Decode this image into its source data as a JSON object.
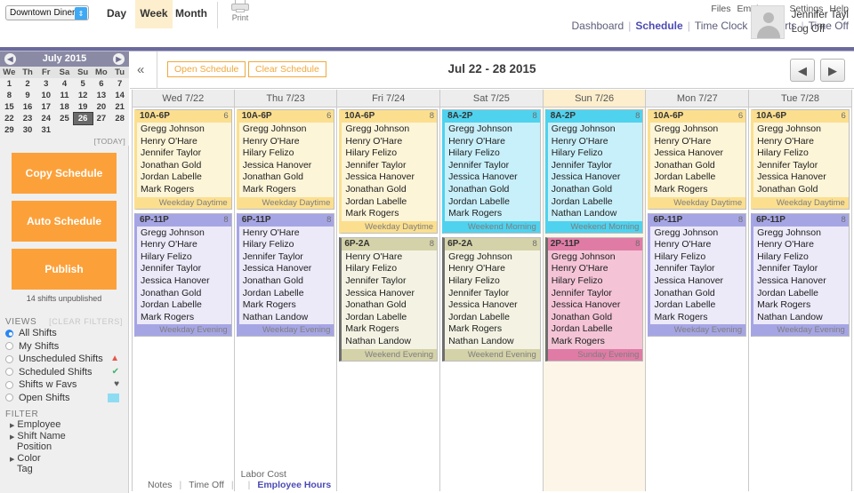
{
  "topbar": {
    "store": "Downtown Diner",
    "views": [
      {
        "label": "Day",
        "active": false
      },
      {
        "label": "Week",
        "active": true
      },
      {
        "label": "Month",
        "active": false
      }
    ],
    "print_label": "Print",
    "secondary_links": [
      "Files",
      "Employees",
      "Settings",
      "Help"
    ],
    "primary_links": [
      {
        "label": "Dashboard",
        "current": false
      },
      {
        "label": "Schedule",
        "current": true
      },
      {
        "label": "Time Clock",
        "current": false
      },
      {
        "label": "Reports",
        "current": false
      },
      {
        "label": "Time Off",
        "current": false
      }
    ],
    "user_name": "Jennifer Tayl",
    "log_off": "Log Off"
  },
  "calendar": {
    "month_label": "July 2015",
    "prev_icon": "◀",
    "next_icon": "▶",
    "weekdays": [
      "We",
      "Th",
      "Fr",
      "Sa",
      "Su",
      "Mo",
      "Tu"
    ],
    "weeks": [
      [
        "1",
        "2",
        "3",
        "4",
        "5",
        "6",
        "7"
      ],
      [
        "8",
        "9",
        "10",
        "11",
        "12",
        "13",
        "14"
      ],
      [
        "15",
        "16",
        "17",
        "18",
        "19",
        "20",
        "21"
      ],
      [
        "22",
        "23",
        "24",
        "25",
        "26",
        "27",
        "28"
      ],
      [
        "29",
        "30",
        "31",
        "",
        "",
        "",
        ""
      ]
    ],
    "selected_day": "26",
    "today_label": "[TODAY]"
  },
  "actions": {
    "copy_schedule": "Copy Schedule",
    "auto_schedule": "Auto Schedule",
    "publish": "Publish",
    "unpublished_note": "14 shifts unpublished"
  },
  "views_panel": {
    "title": "VIEWS",
    "clear_filters": "[CLEAR FILTERS]",
    "options": [
      {
        "label": "All Shifts",
        "selected": true,
        "icon": "",
        "icon_color": ""
      },
      {
        "label": "My Shifts",
        "selected": false,
        "icon": "",
        "icon_color": ""
      },
      {
        "label": "Unscheduled Shifts",
        "selected": false,
        "icon": "warning-triangle",
        "icon_color": "#e8544a"
      },
      {
        "label": "Scheduled Shifts",
        "selected": false,
        "icon": "check-circle",
        "icon_color": "#43b36b"
      },
      {
        "label": "Shifts w Favs",
        "selected": false,
        "icon": "heart",
        "icon_color": "#5a5a5a"
      },
      {
        "label": "Open Shifts",
        "selected": false,
        "icon": "swatch",
        "icon_color": "#8ddcf2"
      }
    ]
  },
  "filter_panel": {
    "title": "FILTER",
    "items": [
      {
        "label": "Employee",
        "expandable": true
      },
      {
        "label": "Shift Name",
        "expandable": true
      },
      {
        "label": "Position",
        "expandable": false
      },
      {
        "label": "Color",
        "expandable": true
      },
      {
        "label": "Tag",
        "expandable": false
      }
    ]
  },
  "schedule_toolbar": {
    "collapse_icon": "«",
    "open_schedule": "Open Schedule",
    "clear_schedule": "Clear Schedule",
    "date_range": "Jul 22 - 28 2015",
    "prev_icon": "◀",
    "next_icon": "▶"
  },
  "columns": [
    {
      "header": "Wed 7/22",
      "highlight": false,
      "shifts": [
        {
          "time": "10A-6P",
          "count": "6",
          "label": "Weekday Daytime",
          "header_color": "#fbdf8f",
          "body_color": "#fdf5d8",
          "accent_color": "#fbdf8f",
          "names": [
            "Gregg Johnson",
            "Henry O'Hare",
            "Jennifer Taylor",
            "Jonathan Gold",
            "Jordan Labelle",
            "Mark Rogers"
          ]
        },
        {
          "time": "6P-11P",
          "count": "8",
          "label": "Weekday Evening",
          "header_color": "#a6a5e4",
          "body_color": "#eceaf9",
          "accent_color": "#a6a5e4",
          "names": [
            "Gregg Johnson",
            "Henry O'Hare",
            "Hilary Felizo",
            "Jennifer Taylor",
            "Jessica Hanover",
            "Jonathan Gold",
            "Jordan Labelle",
            "Mark Rogers"
          ]
        }
      ]
    },
    {
      "header": "Thu 7/23",
      "highlight": false,
      "shifts": [
        {
          "time": "10A-6P",
          "count": "6",
          "label": "Weekday Daytime",
          "header_color": "#fbdf8f",
          "body_color": "#fdf5d8",
          "accent_color": "#fbdf8f",
          "names": [
            "Gregg Johnson",
            "Henry O'Hare",
            "Hilary Felizo",
            "Jessica Hanover",
            "Jonathan Gold",
            "Mark Rogers"
          ]
        },
        {
          "time": "6P-11P",
          "count": "8",
          "label": "Weekday Evening",
          "header_color": "#a6a5e4",
          "body_color": "#eceaf9",
          "accent_color": "#a6a5e4",
          "names": [
            "Henry O'Hare",
            "Hilary Felizo",
            "Jennifer Taylor",
            "Jessica Hanover",
            "Jonathan Gold",
            "Jordan Labelle",
            "Mark Rogers",
            "Nathan Landow"
          ]
        }
      ]
    },
    {
      "header": "Fri 7/24",
      "highlight": false,
      "shifts": [
        {
          "time": "10A-6P",
          "count": "8",
          "label": "Weekday Daytime",
          "header_color": "#fbdf8f",
          "body_color": "#fdf5d8",
          "accent_color": "#fbdf8f",
          "names": [
            "Gregg Johnson",
            "Henry O'Hare",
            "Hilary Felizo",
            "Jennifer Taylor",
            "Jessica Hanover",
            "Jonathan Gold",
            "Jordan Labelle",
            "Mark Rogers"
          ]
        },
        {
          "time": "6P-2A",
          "count": "8",
          "label": "Weekend Evening",
          "header_color": "#d4d2a8",
          "body_color": "#f4f3e3",
          "accent_color": "#6e6e6e",
          "names": [
            "Henry O'Hare",
            "Hilary Felizo",
            "Jennifer Taylor",
            "Jessica Hanover",
            "Jonathan Gold",
            "Jordan Labelle",
            "Mark Rogers",
            "Nathan Landow"
          ]
        }
      ]
    },
    {
      "header": "Sat 7/25",
      "highlight": false,
      "shifts": [
        {
          "time": "8A-2P",
          "count": "8",
          "label": "Weekend Morning",
          "header_color": "#4fd2ee",
          "body_color": "#c8f0fa",
          "accent_color": "#4fd2ee",
          "names": [
            "Gregg Johnson",
            "Henry O'Hare",
            "Hilary Felizo",
            "Jennifer Taylor",
            "Jessica Hanover",
            "Jonathan Gold",
            "Jordan Labelle",
            "Mark Rogers"
          ]
        },
        {
          "time": "6P-2A",
          "count": "8",
          "label": "Weekend Evening",
          "header_color": "#d4d2a8",
          "body_color": "#f4f3e3",
          "accent_color": "#6e6e6e",
          "names": [
            "Gregg Johnson",
            "Henry O'Hare",
            "Hilary Felizo",
            "Jennifer Taylor",
            "Jessica Hanover",
            "Jordan Labelle",
            "Mark Rogers",
            "Nathan Landow"
          ]
        }
      ]
    },
    {
      "header": "Sun 7/26",
      "highlight": true,
      "shifts": [
        {
          "time": "8A-2P",
          "count": "8",
          "label": "Weekend Morning",
          "header_color": "#4fd2ee",
          "body_color": "#c8f0fa",
          "accent_color": "#4fd2ee",
          "names": [
            "Gregg Johnson",
            "Henry O'Hare",
            "Hilary Felizo",
            "Jennifer Taylor",
            "Jessica Hanover",
            "Jonathan Gold",
            "Jordan Labelle",
            "Nathan Landow"
          ]
        },
        {
          "time": "2P-11P",
          "count": "8",
          "label": "Sunday Evening",
          "header_color": "#e07ba6",
          "body_color": "#f4c4d6",
          "accent_color": "#6e6e6e",
          "names": [
            "Gregg Johnson",
            "Henry O'Hare",
            "Hilary Felizo",
            "Jennifer Taylor",
            "Jessica Hanover",
            "Jonathan Gold",
            "Jordan Labelle",
            "Mark Rogers"
          ]
        }
      ]
    },
    {
      "header": "Mon 7/27",
      "highlight": false,
      "shifts": [
        {
          "time": "10A-6P",
          "count": "6",
          "label": "Weekday Daytime",
          "header_color": "#fbdf8f",
          "body_color": "#fdf5d8",
          "accent_color": "#fbdf8f",
          "names": [
            "Gregg Johnson",
            "Henry O'Hare",
            "Jessica Hanover",
            "Jonathan Gold",
            "Jordan Labelle",
            "Mark Rogers"
          ]
        },
        {
          "time": "6P-11P",
          "count": "8",
          "label": "Weekday Evening",
          "header_color": "#a6a5e4",
          "body_color": "#eceaf9",
          "accent_color": "#a6a5e4",
          "names": [
            "Gregg Johnson",
            "Henry O'Hare",
            "Hilary Felizo",
            "Jennifer Taylor",
            "Jessica Hanover",
            "Jonathan Gold",
            "Jordan Labelle",
            "Mark Rogers"
          ]
        }
      ]
    },
    {
      "header": "Tue 7/28",
      "highlight": false,
      "shifts": [
        {
          "time": "10A-6P",
          "count": "6",
          "label": "Weekday Daytime",
          "header_color": "#fbdf8f",
          "body_color": "#fdf5d8",
          "accent_color": "#fbdf8f",
          "names": [
            "Gregg Johnson",
            "Henry O'Hare",
            "Hilary Felizo",
            "Jennifer Taylor",
            "Jessica Hanover",
            "Jonathan Gold"
          ]
        },
        {
          "time": "6P-11P",
          "count": "8",
          "label": "Weekday Evening",
          "header_color": "#a6a5e4",
          "body_color": "#eceaf9",
          "accent_color": "#a6a5e4",
          "names": [
            "Gregg Johnson",
            "Henry O'Hare",
            "Hilary Felizo",
            "Jennifer Taylor",
            "Jessica Hanover",
            "Jordan Labelle",
            "Mark Rogers",
            "Nathan Landow"
          ]
        }
      ]
    }
  ],
  "footer": {
    "tabs": [
      {
        "label": "Notes",
        "current": false
      },
      {
        "label": "Time Off",
        "current": false
      },
      {
        "label": "Labor Cost",
        "current": false
      },
      {
        "label": "Employee Hours",
        "current": true
      }
    ]
  }
}
